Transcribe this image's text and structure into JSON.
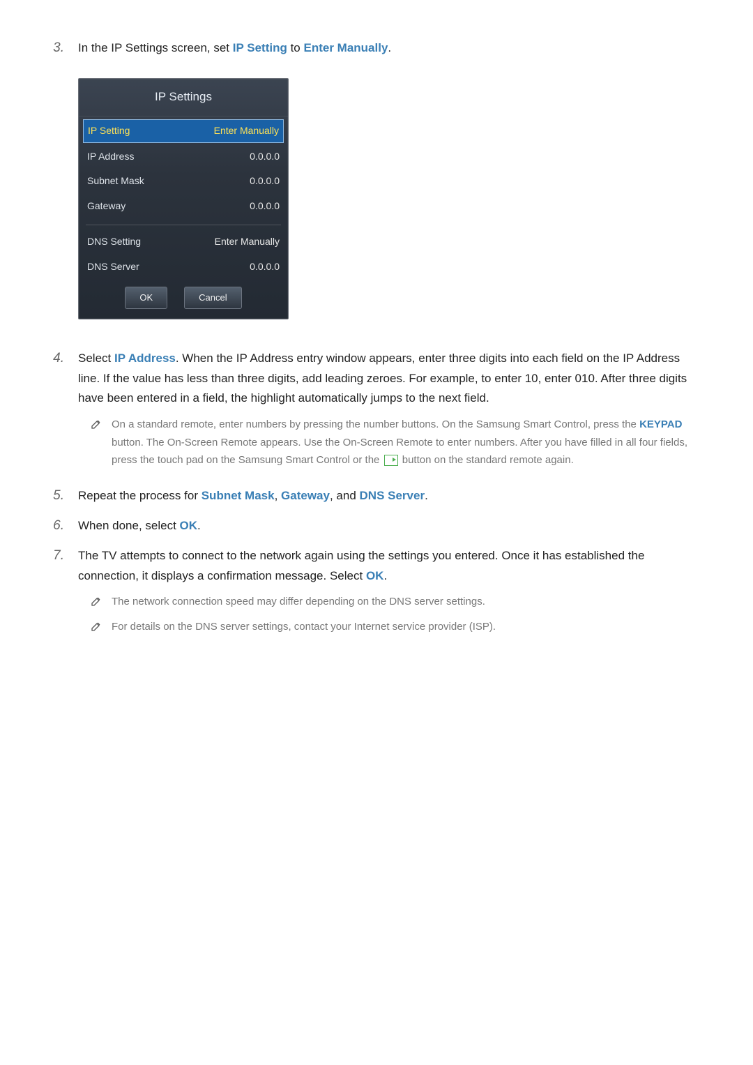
{
  "steps": {
    "s3": {
      "num": "3.",
      "text_a": "In the IP Settings screen, set ",
      "hl1": "IP Setting",
      "text_b": " to ",
      "hl2": "Enter Manually",
      "text_c": "."
    },
    "s4": {
      "num": "4.",
      "text_a": "Select ",
      "hl1": "IP Address",
      "text_b": ". When the IP Address entry window appears, enter three digits into each field on the IP Address line. If the value has less than three digits, add leading zeroes. For example, to enter 10, enter 010. After three digits have been entered in a field, the highlight automatically jumps to the next field.",
      "note1_a": "On a standard remote, enter numbers by pressing the number buttons. On the Samsung Smart Control, press the ",
      "note1_hl": "KEYPAD",
      "note1_b": " button. The On-Screen Remote appears. Use the On-Screen Remote to enter numbers. After you have filled in all four fields, press the touch pad on the Samsung Smart Control or the ",
      "note1_c": " button on the standard remote again."
    },
    "s5": {
      "num": "5.",
      "text_a": "Repeat the process for ",
      "hl1": "Subnet Mask",
      "sep1": ", ",
      "hl2": "Gateway",
      "sep2": ", and ",
      "hl3": "DNS Server",
      "text_b": "."
    },
    "s6": {
      "num": "6.",
      "text_a": "When done, select ",
      "hl1": "OK",
      "text_b": "."
    },
    "s7": {
      "num": "7.",
      "text_a": "The TV attempts to connect to the network again using the settings you entered. Once it has established the connection, it displays a confirmation message. Select ",
      "hl1": "OK",
      "text_b": ".",
      "note1": "The network connection speed may differ depending on the DNS server settings.",
      "note2": "For details on the DNS server settings, contact your Internet service provider (ISP)."
    }
  },
  "panel": {
    "title": "IP Settings",
    "rows": [
      {
        "label": "IP Setting",
        "value": "Enter Manually",
        "selected": true
      },
      {
        "label": "IP Address",
        "value": "0.0.0.0"
      },
      {
        "label": "Subnet Mask",
        "value": "0.0.0.0"
      },
      {
        "label": "Gateway",
        "value": "0.0.0.0"
      }
    ],
    "rows2": [
      {
        "label": "DNS Setting",
        "value": "Enter Manually"
      },
      {
        "label": "DNS Server",
        "value": "0.0.0.0"
      }
    ],
    "ok": "OK",
    "cancel": "Cancel"
  }
}
